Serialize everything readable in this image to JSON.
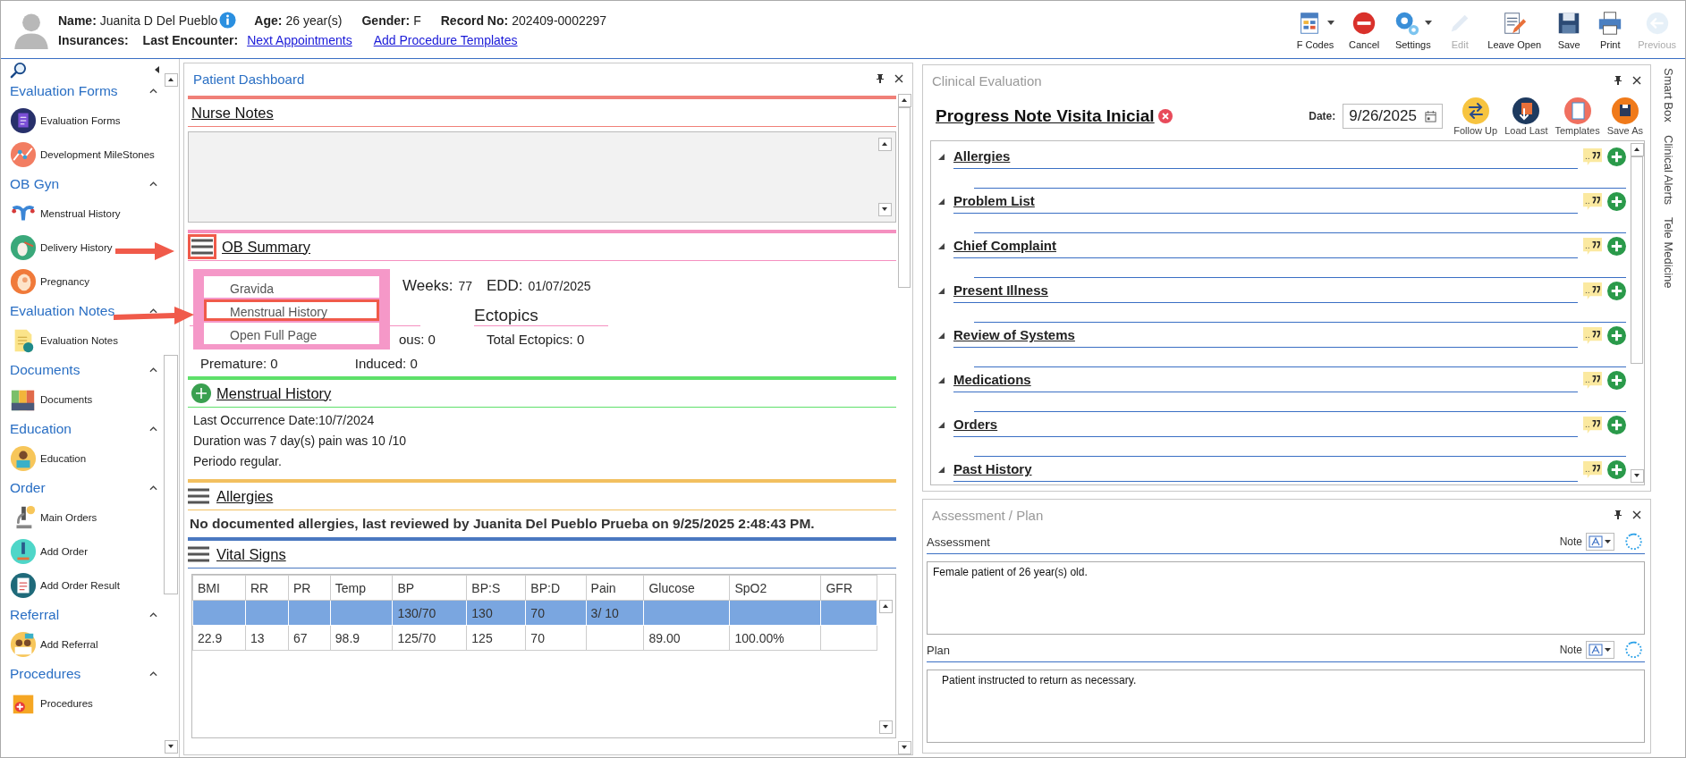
{
  "patient": {
    "fields": [
      {
        "label": "Name:",
        "value": "Juanita D Del Pueblo",
        "info": true
      },
      {
        "label": "Age:",
        "value": "26 year(s)",
        "info": false
      },
      {
        "label": "Gender:",
        "value": "F",
        "info": false
      },
      {
        "label": "Record No:",
        "value": "202409-0002297",
        "info": false
      }
    ],
    "labels": [
      "Insurances:",
      "Last Encounter:"
    ],
    "links": [
      "Next Appointments",
      "Add Procedure Templates"
    ]
  },
  "toolbar": [
    {
      "label": "F Codes",
      "kind": "fcodes",
      "dropdown": true,
      "disabled": false
    },
    {
      "label": "Cancel",
      "kind": "cancel",
      "dropdown": false,
      "disabled": false
    },
    {
      "label": "Settings",
      "kind": "settings",
      "dropdown": true,
      "disabled": false
    },
    {
      "label": "Edit",
      "kind": "edit",
      "dropdown": false,
      "disabled": true
    },
    {
      "label": "Leave Open",
      "kind": "leave",
      "dropdown": false,
      "disabled": false
    },
    {
      "label": "Save",
      "kind": "save",
      "dropdown": false,
      "disabled": false
    },
    {
      "label": "Print",
      "kind": "print",
      "dropdown": false,
      "disabled": false
    },
    {
      "label": "Previous",
      "kind": "previous",
      "dropdown": false,
      "disabled": true
    }
  ],
  "sidebar": {
    "groups": [
      {
        "title": "Evaluation Forms",
        "expanded": true,
        "items": [
          {
            "label": "Evaluation Forms",
            "kind": "form"
          },
          {
            "label": "Development MileStones",
            "kind": "milestones"
          }
        ]
      },
      {
        "title": "OB Gyn",
        "expanded": true,
        "items": [
          {
            "label": "Menstrual History",
            "kind": "uterus"
          },
          {
            "label": "Delivery History",
            "kind": "stork"
          },
          {
            "label": "Pregnancy",
            "kind": "baby"
          }
        ]
      },
      {
        "title": "Evaluation Notes",
        "expanded": true,
        "items": [
          {
            "label": "Evaluation Notes",
            "kind": "note"
          }
        ]
      },
      {
        "title": "Documents",
        "expanded": true,
        "items": [
          {
            "label": "Documents",
            "kind": "books"
          }
        ]
      },
      {
        "title": "Education",
        "expanded": true,
        "items": [
          {
            "label": "Education",
            "kind": "reader"
          }
        ]
      },
      {
        "title": "Order",
        "expanded": true,
        "items": [
          {
            "label": "Main Orders",
            "kind": "microscope"
          },
          {
            "label": "Add Order",
            "kind": "microscope2"
          },
          {
            "label": "Add Order Result",
            "kind": "clipboard"
          }
        ]
      },
      {
        "title": "Referral",
        "expanded": true,
        "items": [
          {
            "label": "Add Referral",
            "kind": "people"
          }
        ]
      },
      {
        "title": "Procedures",
        "expanded": true,
        "items": [
          {
            "label": "Procedures",
            "kind": "procedure"
          }
        ]
      }
    ]
  },
  "dashboard": {
    "title": "Patient Dashboard",
    "sections": [
      {
        "kind": "notes",
        "title": "Nurse Notes",
        "color": "#f08078"
      },
      {
        "kind": "ob",
        "title": "OB Summary",
        "color": "#f590c0",
        "highlighted": true,
        "weeks_label": "Weeks:",
        "weeks": "77",
        "edd_label": "EDD:",
        "edd": "01/07/2025",
        "partial_text": "ous: 0",
        "ectopics_title": "Ectopics",
        "total_ectopics": "Total Ectopics: 0",
        "premature": "Premature: 0",
        "induced": "Induced: 0",
        "menu": [
          {
            "label": "Gravida",
            "highlighted": false
          },
          {
            "label": "Menstrual History",
            "highlighted": true
          },
          {
            "label": "Open Full Page",
            "highlighted": false
          }
        ]
      },
      {
        "kind": "menstrual",
        "title": "Menstrual History",
        "color": "#5ee06a",
        "lines": [
          "Last Occurrence Date:10/7/2024",
          "Duration was 7 day(s) pain was 10 /10",
          "Periodo regular."
        ]
      },
      {
        "kind": "allergies",
        "title": "Allergies",
        "color": "#f2c060",
        "highlighted": false,
        "summary": "No documented allergies, last reviewed by Juanita Del Pueblo Prueba on 9/25/2025 2:48:43 PM."
      },
      {
        "kind": "vitals",
        "title": "Vital Signs",
        "color": "#4a78c0",
        "highlighted": false,
        "columns": [
          "BMI",
          "RR",
          "PR",
          "Temp",
          "BP",
          "BP:S",
          "BP:D",
          "Pain",
          "Glucose",
          "SpO2",
          "GFR"
        ],
        "rows": [
          {
            "selected": true,
            "cells": [
              null,
              null,
              null,
              null,
              "130/70",
              "130",
              "70",
              "3/ 10",
              null,
              null,
              null
            ]
          },
          {
            "selected": false,
            "cells": [
              "22.9",
              "13",
              "67",
              "98.9",
              "125/70",
              "125",
              "70",
              null,
              "89.00",
              "100.00%",
              null
            ]
          }
        ]
      }
    ]
  },
  "clinical": {
    "title": "Clinical Evaluation",
    "note_title": "Progress Note Visita Inicial",
    "date_label": "Date:",
    "date": "9/26/2025",
    "actions": [
      {
        "label": "Follow Up",
        "kind": "follow"
      },
      {
        "label": "Load Last",
        "kind": "load"
      },
      {
        "label": "Templates",
        "kind": "templates"
      },
      {
        "label": "Save As",
        "kind": "saveas"
      }
    ],
    "sections": [
      {
        "title": "Allergies",
        "expanded": true
      },
      {
        "title": "Problem List",
        "expanded": true
      },
      {
        "title": "Chief Complaint",
        "expanded": true
      },
      {
        "title": "Present Illness",
        "expanded": true
      },
      {
        "title": "Review of Systems",
        "expanded": true
      },
      {
        "title": "Medications",
        "expanded": true
      },
      {
        "title": "Orders",
        "expanded": true
      },
      {
        "title": "Past History",
        "expanded": true
      }
    ]
  },
  "assessment": {
    "title": "Assessment / Plan",
    "fields": [
      {
        "label": "Assessment",
        "note_label": "Note",
        "text": "Female patient of 26 year(s) old."
      },
      {
        "label": "Plan",
        "note_label": "Note",
        "text": "Patient instructed to return as necessary."
      }
    ]
  },
  "side_tabs": [
    "Smart Box",
    "Clinical Alerts",
    "Tele Medicine"
  ]
}
